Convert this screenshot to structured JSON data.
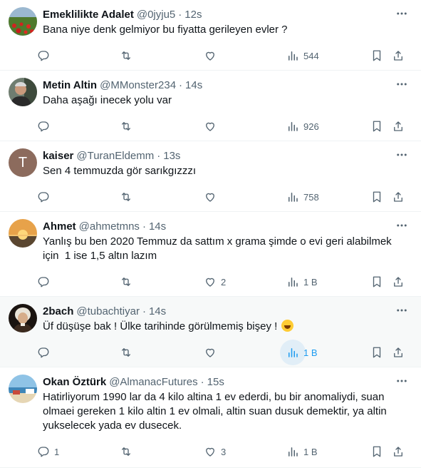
{
  "colors": {
    "secondary": "#536471",
    "accent": "#1d9bf0",
    "highlight_bg": "#f7f9f9"
  },
  "tweets": [
    {
      "name": "Emeklilikte Adalet",
      "handle": "@0jyju5",
      "time": "12s",
      "text": [
        "Bana niye denk gelmiyor bu fiyatta gerileyen evler ?"
      ],
      "replies": "",
      "likes": "",
      "views": "544",
      "avatar": "poppy-field"
    },
    {
      "name": "Metin Altin",
      "handle": "@MMonster234",
      "time": "14s",
      "text": [
        "Daha aşağı inecek yolu var"
      ],
      "replies": "",
      "likes": "",
      "views": "926",
      "avatar": "man-photo"
    },
    {
      "name": "kaiser",
      "handle": "@TuranEldemm",
      "time": "13s",
      "text": [
        "Sen 4 temmuzda gör sarıkgızzzı"
      ],
      "replies": "",
      "likes": "",
      "views": "758",
      "avatar_letter": "T"
    },
    {
      "name": "Ahmet",
      "handle": "@ahmetmns",
      "time": "14s",
      "text": [
        "Yanlış bu ben 2020 Temmuz da sattım x grama şimde o evi geri alabilmek",
        "için  1 ise 1,5 altın lazım"
      ],
      "replies": "",
      "likes": "2",
      "views": "1 B",
      "avatar": "sunset"
    },
    {
      "name": "2bach",
      "handle": "@tubachtiyar",
      "time": "14s",
      "text": [
        "Üf düşüşe bak ! Ülke tarihinde görülmemiş bişey !"
      ],
      "emoji": "rolling-laughing-emoji",
      "replies": "",
      "likes": "",
      "views": "1 B",
      "avatar": "bach-portrait"
    },
    {
      "name": "Okan Öztürk",
      "handle": "@AlmanacFutures",
      "time": "15s",
      "text": [
        "Hatirliyorum 1990 lar da 4 kilo altina 1 ev ederdi, bu bir anomaliydi, suan",
        "olmaei gereken 1 kilo altin 1 ev olmali, altin suan dusuk demektir, ya altin",
        "yukselecek yada ev dusecek."
      ],
      "replies": "1",
      "likes": "3",
      "views": "1 B",
      "avatar": "beach"
    }
  ],
  "icons": [
    "reply-icon",
    "retweet-icon",
    "like-icon",
    "views-icon",
    "bookmark-icon",
    "share-icon",
    "more-icon"
  ]
}
